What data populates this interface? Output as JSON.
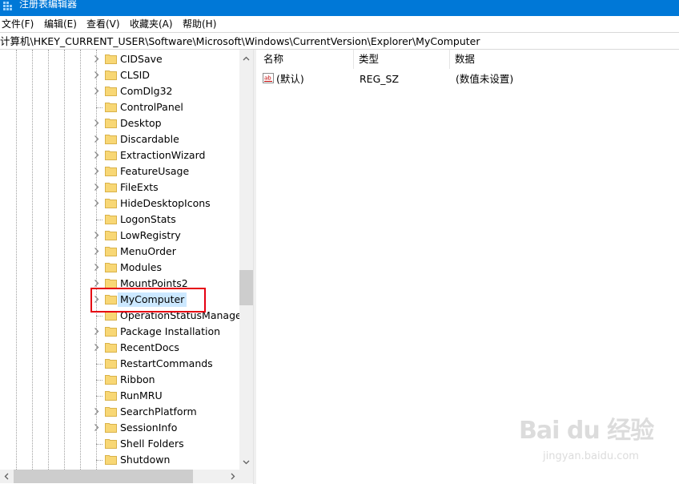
{
  "window": {
    "title": "注册表编辑器"
  },
  "menu": [
    {
      "label": "文件(F)"
    },
    {
      "label": "编辑(E)"
    },
    {
      "label": "查看(V)"
    },
    {
      "label": "收藏夹(A)"
    },
    {
      "label": "帮助(H)"
    }
  ],
  "address": {
    "path": "计算机\\HKEY_CURRENT_USER\\Software\\Microsoft\\Windows\\CurrentVersion\\Explorer\\MyComputer"
  },
  "tree": {
    "items": [
      {
        "label": "CIDSave",
        "expandable": true
      },
      {
        "label": "CLSID",
        "expandable": true
      },
      {
        "label": "ComDlg32",
        "expandable": true
      },
      {
        "label": "ControlPanel",
        "expandable": false
      },
      {
        "label": "Desktop",
        "expandable": true
      },
      {
        "label": "Discardable",
        "expandable": true
      },
      {
        "label": "ExtractionWizard",
        "expandable": true
      },
      {
        "label": "FeatureUsage",
        "expandable": true
      },
      {
        "label": "FileExts",
        "expandable": true
      },
      {
        "label": "HideDesktopIcons",
        "expandable": true
      },
      {
        "label": "LogonStats",
        "expandable": false
      },
      {
        "label": "LowRegistry",
        "expandable": true
      },
      {
        "label": "MenuOrder",
        "expandable": true
      },
      {
        "label": "Modules",
        "expandable": true
      },
      {
        "label": "MountPoints2",
        "expandable": true
      },
      {
        "label": "MyComputer",
        "expandable": true,
        "selected": true
      },
      {
        "label": "OperationStatusManager",
        "expandable": false
      },
      {
        "label": "Package Installation",
        "expandable": true
      },
      {
        "label": "RecentDocs",
        "expandable": true
      },
      {
        "label": "RestartCommands",
        "expandable": false
      },
      {
        "label": "Ribbon",
        "expandable": false
      },
      {
        "label": "RunMRU",
        "expandable": false
      },
      {
        "label": "SearchPlatform",
        "expandable": true
      },
      {
        "label": "SessionInfo",
        "expandable": true
      },
      {
        "label": "Shell Folders",
        "expandable": false
      },
      {
        "label": "Shutdown",
        "expandable": false
      }
    ]
  },
  "columns": {
    "name": "名称",
    "type": "类型",
    "data": "数据"
  },
  "values": [
    {
      "name": "(默认)",
      "type": "REG_SZ",
      "data": "(数值未设置)",
      "icon": "ab-string-icon"
    }
  ],
  "watermark": {
    "big": "Bai du 经验",
    "small": "jingyan.baidu.com"
  },
  "colors": {
    "titlebar": "#0078d7",
    "selection": "#cce8ff",
    "highlight_box": "#e60012",
    "folder": "#f8d775"
  }
}
